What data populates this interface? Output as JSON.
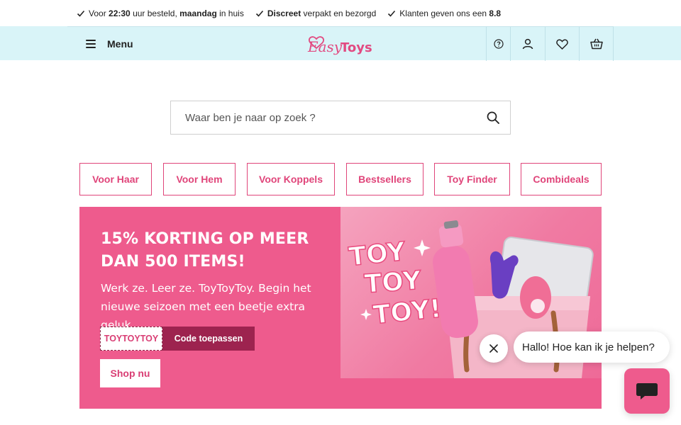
{
  "usp": [
    {
      "parts": [
        {
          "t": "Voor ",
          "b": false
        },
        {
          "t": "22:30",
          "b": true
        },
        {
          "t": " uur besteld, ",
          "b": false
        },
        {
          "t": "maandag",
          "b": true
        },
        {
          "t": " in huis",
          "b": false
        }
      ]
    },
    {
      "parts": [
        {
          "t": "Discreet",
          "b": true
        },
        {
          "t": " verpakt en bezorgd",
          "b": false
        }
      ]
    },
    {
      "parts": [
        {
          "t": "Klanten geven ons een ",
          "b": false
        },
        {
          "t": "8.8",
          "b": true
        }
      ]
    }
  ],
  "header": {
    "menu_label": "Menu",
    "logo": {
      "part1": "Easy",
      "part2": "Toys"
    },
    "icons": [
      "help-icon",
      "account-icon",
      "wishlist-heart-icon",
      "cart-basket-icon"
    ]
  },
  "search": {
    "placeholder": "Waar ben je naar op zoek ?"
  },
  "categories": [
    "Voor Haar",
    "Voor Hem",
    "Voor Koppels",
    "Bestsellers",
    "Toy Finder",
    "Combideals"
  ],
  "banner": {
    "title_line1": "15% KORTING OP MEER",
    "title_line2": "DAN 500 ITEMS!",
    "subtitle_line1": "Werk ze. Leer ze. ToyToyToy. Begin het",
    "subtitle_line2": "nieuwe seizoen met een beetje extra geluk.",
    "code": "TOYTOYTOY",
    "apply_label": "Code toepassen",
    "shop_label": "Shop nu",
    "image_text": [
      "TOY",
      "TOY",
      "TOY!"
    ]
  },
  "chat": {
    "greeting": "Hallo! Hoe kan ik je helpen?"
  },
  "colors": {
    "brand_pink": "#ee5b8d",
    "header_bg": "#d9f4f8",
    "accent_dark": "#9d234f"
  }
}
